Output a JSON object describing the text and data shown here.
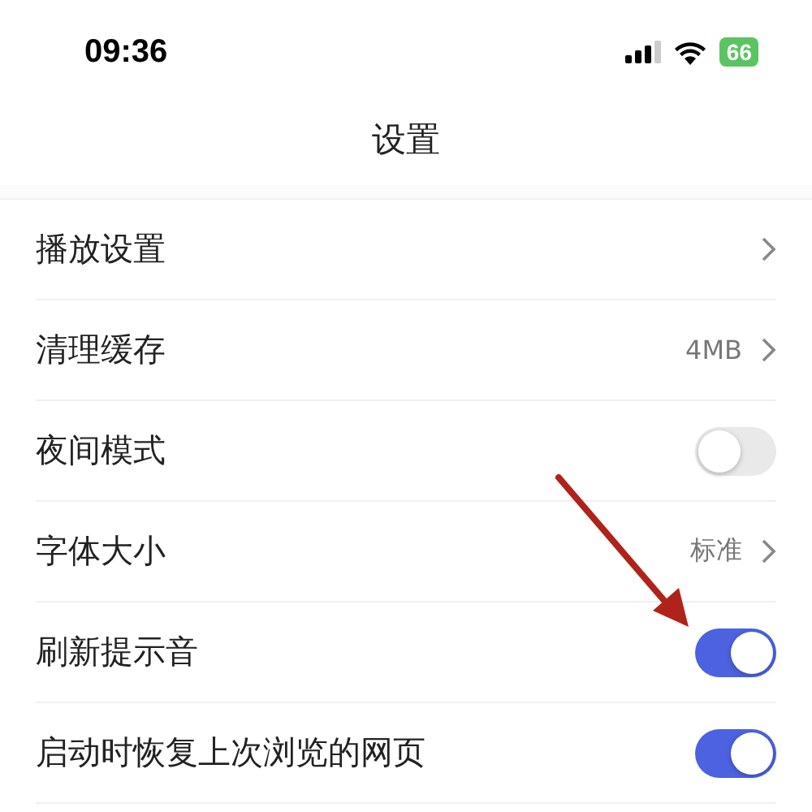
{
  "status_bar": {
    "time": "09:36",
    "battery": "66"
  },
  "title": "设置",
  "rows": [
    {
      "kind": "link",
      "label": "播放设置"
    },
    {
      "kind": "link",
      "label": "清理缓存",
      "value": "4MB"
    },
    {
      "kind": "toggle",
      "label": "夜间模式",
      "on": false
    },
    {
      "kind": "link",
      "label": "字体大小",
      "value": "标准"
    },
    {
      "kind": "toggle",
      "label": "刷新提示音",
      "on": true
    },
    {
      "kind": "toggle",
      "label": "启动时恢复上次浏览的网页",
      "on": true
    }
  ]
}
